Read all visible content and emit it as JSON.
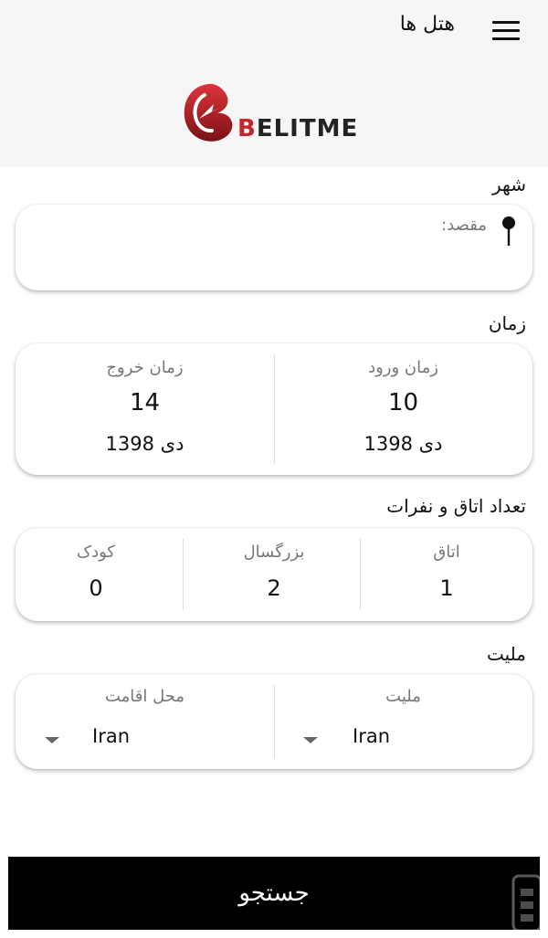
{
  "header": {
    "title": "هتل ها",
    "menu_icon": "hamburger-menu-icon"
  },
  "logo": {
    "brand": "BELITME",
    "brand_color": "#c4262e"
  },
  "city": {
    "label": "شهر",
    "placeholder": "مقصد:",
    "icon": "map-pin-icon"
  },
  "time": {
    "label": "زمان",
    "checkin": {
      "label": "زمان ورود",
      "day": "10",
      "month_year": "دی 1398"
    },
    "checkout": {
      "label": "زمان خروج",
      "day": "14",
      "month_year": "دی 1398"
    }
  },
  "rooms": {
    "label": "تعداد اتاق و نفرات",
    "room": {
      "label": "اتاق",
      "value": "1"
    },
    "adult": {
      "label": "بزرگسال",
      "value": "2"
    },
    "child": {
      "label": "کودک",
      "value": "0"
    }
  },
  "nationality": {
    "label": "ملیت",
    "nationality_field": {
      "label": "ملیت",
      "value": "Iran"
    },
    "residence_field": {
      "label": "محل اقامت",
      "value": "Iran"
    }
  },
  "search_button": {
    "label": "جستجو",
    "background": "#000000"
  }
}
